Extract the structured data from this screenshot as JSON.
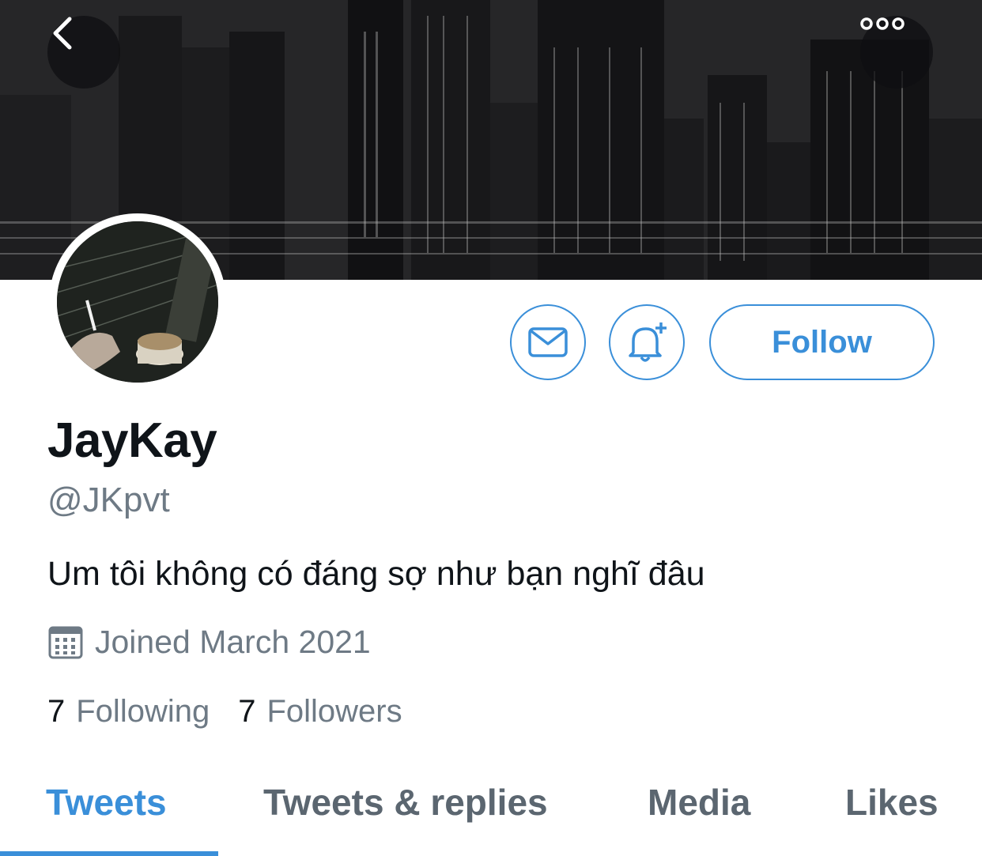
{
  "header": {
    "back_icon": "chevron-left-icon",
    "more_icon": "ellipsis-icon"
  },
  "profile": {
    "display_name": "JayKay",
    "handle": "@JKpvt",
    "bio": "Um tôi không có đáng sợ như bạn nghĩ đâu",
    "joined": "Joined March 2021",
    "following_count": "7",
    "following_label": "Following",
    "followers_count": "7",
    "followers_label": "Followers"
  },
  "actions": {
    "message_icon": "envelope-icon",
    "notify_icon": "bell-plus-icon",
    "follow_label": "Follow"
  },
  "tabs": [
    {
      "label": "Tweets",
      "active": true
    },
    {
      "label": "Tweets & replies",
      "active": false
    },
    {
      "label": "Media",
      "active": false
    },
    {
      "label": "Likes",
      "active": false
    }
  ],
  "colors": {
    "accent": "#3a8fd9",
    "text_primary": "#0f1419",
    "text_secondary": "#6e7a85"
  }
}
